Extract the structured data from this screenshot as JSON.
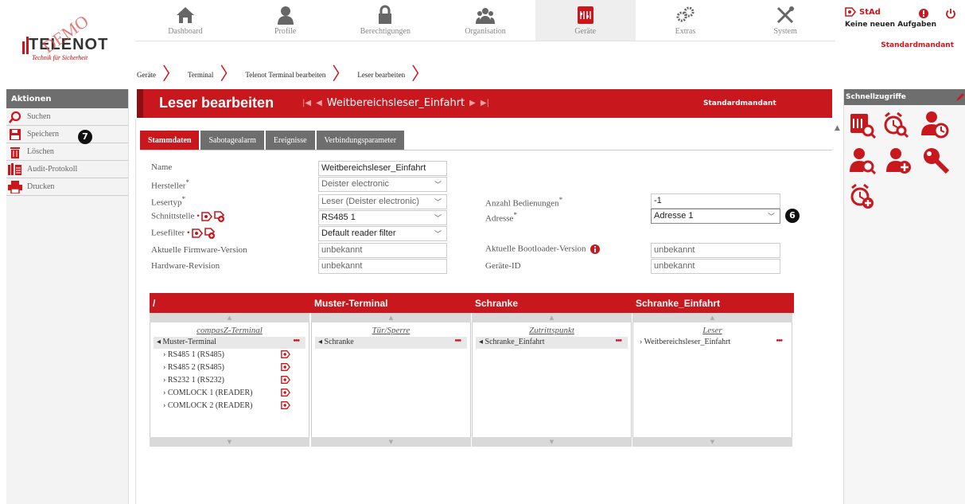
{
  "nav": {
    "items": [
      {
        "label": "Dashboard",
        "icon": "home-icon"
      },
      {
        "label": "Profile",
        "icon": "person-icon"
      },
      {
        "label": "Berechtigungen",
        "icon": "lock-icon"
      },
      {
        "label": "Organisation",
        "icon": "group-icon"
      },
      {
        "label": "Geräte",
        "icon": "device-icon",
        "active": true
      },
      {
        "label": "Extras",
        "icon": "gears-icon"
      },
      {
        "label": "System",
        "icon": "tools-icon"
      }
    ]
  },
  "logo": {
    "brand": "TELENOT",
    "tagline": "Technik für Sicherheit",
    "watermark": "DEMO"
  },
  "user": {
    "name": "StAd",
    "tasks": "Keine neuen Aufgaben",
    "tenant": "Standardmandant"
  },
  "breadcrumb": [
    "Geräte",
    "Terminal",
    "Telenot Terminal bearbeiten",
    "Leser bearbeiten"
  ],
  "actions": {
    "title": "Aktionen",
    "items": [
      {
        "label": "Suchen",
        "icon": "search-icon"
      },
      {
        "label": "Speichern",
        "icon": "save-icon"
      },
      {
        "label": "Löschen",
        "icon": "trash-icon"
      },
      {
        "label": "Audit-Protokoll",
        "icon": "audit-icon"
      },
      {
        "label": "Drucken",
        "icon": "print-icon"
      }
    ]
  },
  "quick": {
    "title": "Schnellzugriffe"
  },
  "header": {
    "title": "Leser bearbeiten",
    "record": "Weitbereichsleser_Einfahrt",
    "tenant": "Standardmandant"
  },
  "tabs": [
    "Stammdaten",
    "Sabotagealarm",
    "Ereignisse",
    "Verbindungsparameter"
  ],
  "form": {
    "name_label": "Name",
    "name_value": "Weitbereichsleser_Einfahrt",
    "hersteller_label": "Hersteller",
    "hersteller_value": "Deister electronic",
    "lesertyp_label": "Lesertyp",
    "lesertyp_value": "Leser (Deister electronic)",
    "schnittstelle_label": "Schnittstelle",
    "schnittstelle_value": "RS485 1",
    "lesefilter_label": "Lesefilter",
    "lesefilter_value": "Default reader filter",
    "firmware_label": "Aktuelle Firmware-Version",
    "firmware_value": "unbekannt",
    "hardware_label": "Hardware-Revision",
    "hardware_value": "unbekannt",
    "bedienungen_label": "Anzahl Bedienungen",
    "bedienungen_value": "-1",
    "adresse_label": "Adresse",
    "adresse_value": "Adresse 1",
    "bootloader_label": "Aktuelle Bootloader-Version",
    "bootloader_value": "unbekannt",
    "geraeteid_label": "Geräte-ID",
    "geraeteid_value": "unbekannt",
    "required_mark": "*"
  },
  "tree": {
    "columns": [
      {
        "header": "/",
        "sub": "compasZ-Terminal",
        "root": "Muster-Terminal",
        "children": [
          "RS485 1 (RS485)",
          "RS485 2 (RS485)",
          "RS232 1 (RS232)",
          "COMLOCK 1 (READER)",
          "COMLOCK 2 (READER)"
        ]
      },
      {
        "header": "Muster-Terminal",
        "sub": "Tür/Sperre",
        "root": "Schranke"
      },
      {
        "header": "Schranke",
        "sub": "Zutrittspunkt",
        "root": "Schranke_Einfahrt"
      },
      {
        "header": "Schranke_Einfahrt",
        "sub": "Leser",
        "leaf": "Weitbereichsleser_Einfahrt"
      }
    ],
    "dots": "•••",
    "expanded_marker": "◂",
    "collapsed_marker": "›"
  },
  "callouts": {
    "six": "6",
    "seven": "7"
  },
  "colors": {
    "accent": "#c8181e",
    "panel": "#6e6e6e"
  }
}
